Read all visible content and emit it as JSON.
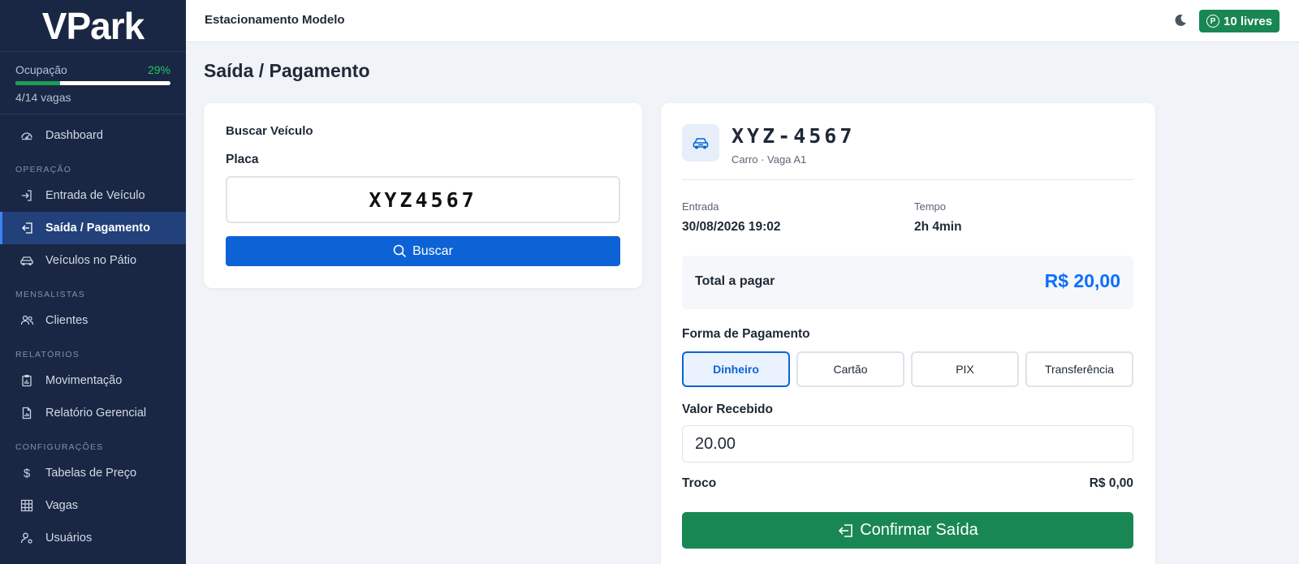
{
  "sidebar": {
    "logo": "VPark",
    "occupancy": {
      "label": "Ocupação",
      "percent_text": "29%",
      "fraction": 0.29,
      "count_text": "4/14 vagas"
    },
    "items": [
      {
        "label": "Dashboard",
        "icon": "gauge-icon"
      },
      {
        "section": "OPERAÇÃO"
      },
      {
        "label": "Entrada de Veículo",
        "icon": "sign-in-icon"
      },
      {
        "label": "Saída / Pagamento",
        "icon": "sign-out-icon",
        "active": true
      },
      {
        "label": "Veículos no Pátio",
        "icon": "car-icon"
      },
      {
        "section": "MENSALISTAS"
      },
      {
        "label": "Clientes",
        "icon": "people-icon"
      },
      {
        "section": "RELATÓRIOS"
      },
      {
        "label": "Movimentação",
        "icon": "clipboard-chart-icon"
      },
      {
        "label": "Relatório Gerencial",
        "icon": "file-chart-icon"
      },
      {
        "section": "CONFIGURAÇÕES"
      },
      {
        "label": "Tabelas de Preço",
        "icon": "dollar-icon"
      },
      {
        "label": "Vagas",
        "icon": "grid-icon"
      },
      {
        "label": "Usuários",
        "icon": "user-gear-icon"
      }
    ]
  },
  "header": {
    "title": "Estacionamento Modelo",
    "free_badge": "10 livres",
    "free_badge_icon": "P"
  },
  "page": {
    "title": "Saída / Pagamento"
  },
  "search": {
    "title": "Buscar Veículo",
    "plate_label": "Placa",
    "plate_value": "XYZ4567",
    "button_label": "Buscar"
  },
  "vehicle": {
    "plate": "XYZ-4567",
    "subtitle": "Carro · Vaga A1",
    "entry_label": "Entrada",
    "entry_value": "30/08/2026 19:02",
    "time_label": "Tempo",
    "time_value": "2h 4min",
    "total_label": "Total a pagar",
    "total_value": "R$ 20,00"
  },
  "payment": {
    "label": "Forma de Pagamento",
    "options": [
      "Dinheiro",
      "Cartão",
      "PIX",
      "Transferência"
    ],
    "selected": "Dinheiro",
    "received_label": "Valor Recebido",
    "received_value": "20.00",
    "change_label": "Troco",
    "change_value": "R$ 0,00",
    "confirm_label": "Confirmar Saída"
  },
  "colors": {
    "sidebar_bg": "#1a2744",
    "primary": "#0d63d6",
    "success": "#198754",
    "accent_total": "#0d6efd"
  }
}
